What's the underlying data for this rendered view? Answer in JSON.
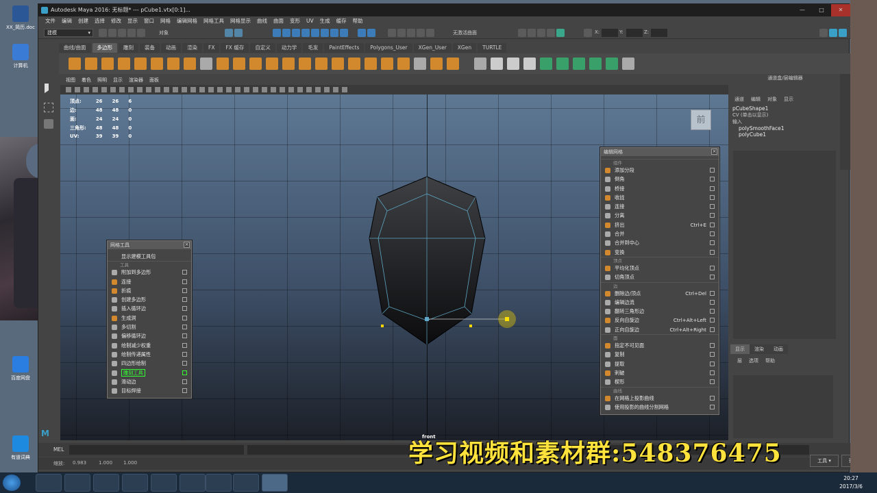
{
  "desktop": {
    "icons": [
      {
        "label": "XX_简历.doc"
      },
      {
        "label": "计算机"
      },
      {
        "label": "百度网盘"
      },
      {
        "label": "有道词典"
      }
    ]
  },
  "window": {
    "title": "Autodesk Maya 2016: 无标题* --- pCube1.vtx[0:1]..."
  },
  "menubar": [
    "文件",
    "编辑",
    "创建",
    "选择",
    "修改",
    "显示",
    "窗口",
    "网格",
    "编辑网格",
    "网格工具",
    "网格显示",
    "曲线",
    "曲面",
    "变形",
    "UV",
    "生成",
    "缓存",
    "帮助"
  ],
  "statusline": {
    "mode": "建模",
    "object_label": "对象",
    "live_surface": "无激活曲面",
    "x_label": "X:",
    "y_label": "Y:",
    "z_label": "Z:"
  },
  "shelf": {
    "tabs": [
      "曲线/曲面",
      "多边形",
      "雕刻",
      "装备",
      "动画",
      "渲染",
      "FX",
      "FX 缓存",
      "自定义",
      "动力学",
      "毛发",
      "PaintEffects",
      "Polygons_User",
      "XGen_User",
      "XGen",
      "TURTLE"
    ],
    "active_tab": "多边形"
  },
  "viewport": {
    "menu": [
      "视图",
      "着色",
      "照明",
      "显示",
      "渲染器",
      "面板"
    ],
    "hud": [
      {
        "label": "顶点:",
        "a": "26",
        "b": "26",
        "c": "6"
      },
      {
        "label": "边:",
        "a": "48",
        "b": "48",
        "c": "0"
      },
      {
        "label": "面:",
        "a": "24",
        "b": "24",
        "c": "0"
      },
      {
        "label": "三角形:",
        "a": "48",
        "b": "48",
        "c": "0"
      },
      {
        "label": "UV:",
        "a": "39",
        "b": "39",
        "c": "0"
      }
    ],
    "camera_label": "front",
    "viewcube_label": "前"
  },
  "mesh_tools_panel": {
    "title": "网格工具",
    "items": [
      {
        "label": "显示建模工具包",
        "section": ""
      },
      {
        "label": "工具",
        "section": "header"
      },
      {
        "label": "附加到多边形"
      },
      {
        "label": "连接"
      },
      {
        "label": "折痕"
      },
      {
        "label": "创建多边形"
      },
      {
        "label": "插入循环边"
      },
      {
        "label": "生成洞"
      },
      {
        "label": "多切割"
      },
      {
        "label": "偏移循环边"
      },
      {
        "label": "绘制减少权重"
      },
      {
        "label": "绘制传递属性"
      },
      {
        "label": "四边形绘制"
      },
      {
        "label": "雕刻工具",
        "highlight": true
      },
      {
        "label": "滑动边"
      },
      {
        "label": "目标焊接"
      }
    ]
  },
  "edit_mesh_panel": {
    "title": "编辑网格",
    "sections": [
      {
        "name": "组件",
        "items": [
          {
            "label": "添加分段",
            "shortcut": ""
          },
          {
            "label": "倒角",
            "shortcut": ""
          },
          {
            "label": "桥接",
            "shortcut": ""
          },
          {
            "label": "收拢",
            "shortcut": ""
          },
          {
            "label": "连接",
            "shortcut": ""
          },
          {
            "label": "分离",
            "shortcut": ""
          },
          {
            "label": "挤出",
            "shortcut": "Ctrl+E"
          },
          {
            "label": "合并",
            "shortcut": ""
          },
          {
            "label": "合并到中心",
            "shortcut": ""
          },
          {
            "label": "变换",
            "shortcut": ""
          }
        ]
      },
      {
        "name": "顶点",
        "items": [
          {
            "label": "平均化顶点",
            "shortcut": ""
          },
          {
            "label": "切角顶点",
            "shortcut": ""
          }
        ]
      },
      {
        "name": "边",
        "items": [
          {
            "label": "删除边/顶点",
            "shortcut": "Ctrl+Del"
          },
          {
            "label": "编辑边流",
            "shortcut": ""
          },
          {
            "label": "翻转三角形边",
            "shortcut": ""
          },
          {
            "label": "反向自旋边",
            "shortcut": "Ctrl+Alt+Left"
          },
          {
            "label": "正向自旋边",
            "shortcut": "Ctrl+Alt+Right"
          }
        ]
      },
      {
        "name": "面",
        "items": [
          {
            "label": "指定不可见面",
            "shortcut": ""
          },
          {
            "label": "复制",
            "shortcut": ""
          },
          {
            "label": "提取",
            "shortcut": ""
          },
          {
            "label": "刺破",
            "shortcut": ""
          },
          {
            "label": "楔形",
            "shortcut": ""
          }
        ]
      },
      {
        "name": "曲线",
        "items": [
          {
            "label": "在网格上投影曲线",
            "shortcut": ""
          },
          {
            "label": "使用投影的曲线分割网格",
            "shortcut": ""
          }
        ]
      }
    ]
  },
  "channel_box": {
    "header": "通道盒/层编辑器",
    "menu": [
      "通道",
      "编辑",
      "对象",
      "显示"
    ],
    "shape": "pCubeShape1",
    "cv_label": "CV (单击以显示)",
    "inputs_label": "输入",
    "inputs": [
      "polySmoothFace1",
      "polyCube1"
    ],
    "layer_tabs": [
      "显示",
      "渲染",
      "动画"
    ],
    "layer_menu": [
      "层",
      "选项",
      "帮助"
    ]
  },
  "cmdline": {
    "label": "MEL"
  },
  "helpline": {
    "label": "缩放:",
    "values": [
      "0.983",
      "1.000",
      "1.000"
    ]
  },
  "bottom_right": {
    "tools": "工具",
    "preview": "预览"
  },
  "watermark": "学习视频和素材群:548376475",
  "taskbar": {
    "time": "20:27",
    "date": "2017/3/6"
  }
}
